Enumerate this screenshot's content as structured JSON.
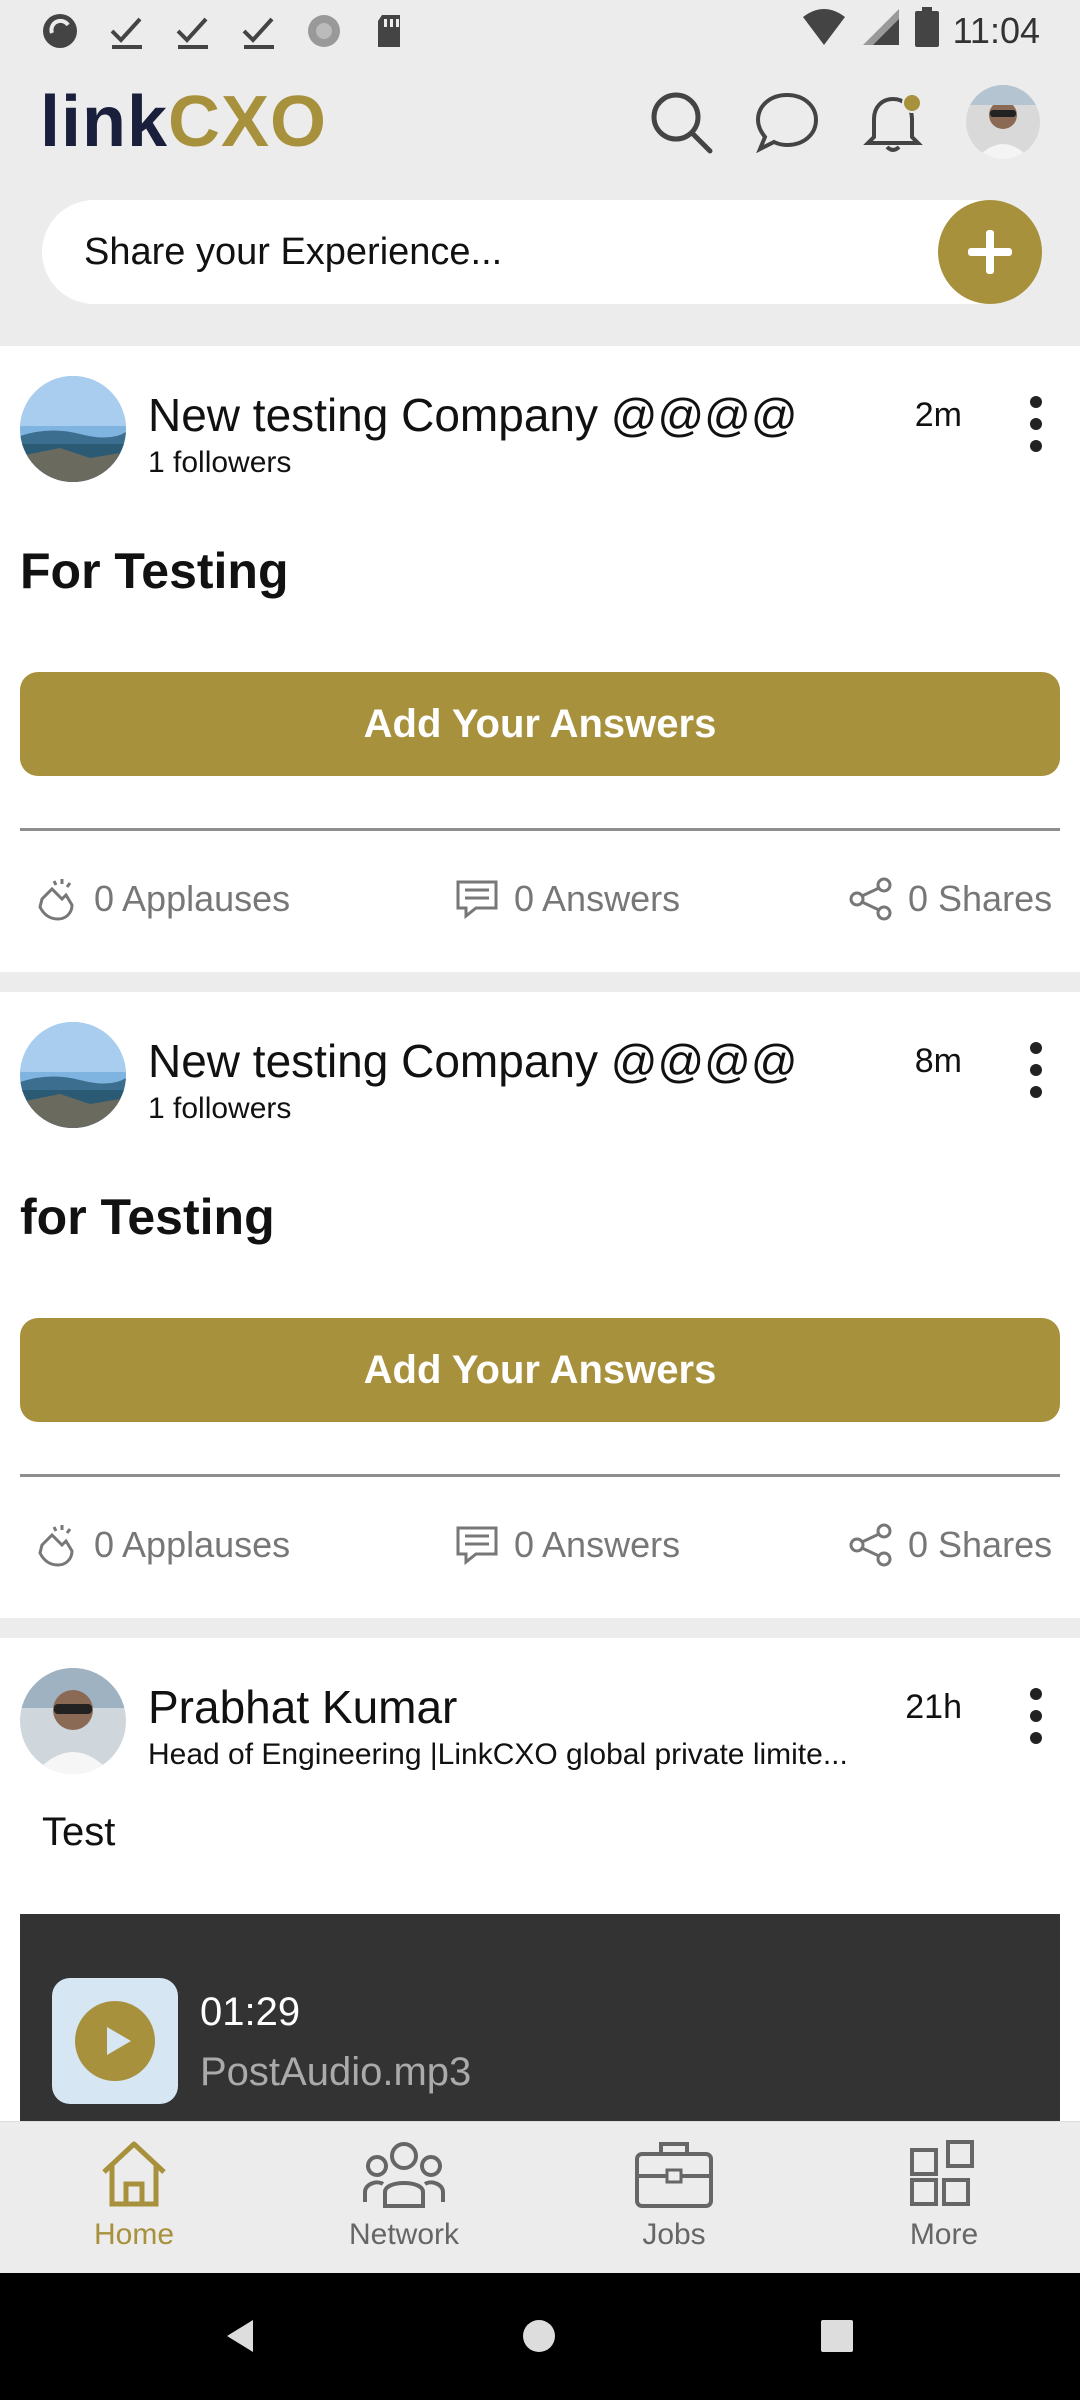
{
  "status_bar": {
    "time": "11:04"
  },
  "header": {
    "logo_link": "link",
    "logo_cxo": "CXO"
  },
  "share": {
    "placeholder": "Share your Experience..."
  },
  "posts": [
    {
      "author": "New testing Company @@@@",
      "followers": "1 followers",
      "time": "2m",
      "title": "For Testing",
      "button": "Add Your Answers",
      "applauses": "0 Applauses",
      "answers": "0 Answers",
      "shares": "0 Shares"
    },
    {
      "author": "New testing Company @@@@",
      "followers": "1 followers",
      "time": "8m",
      "title": "for Testing",
      "button": "Add Your Answers",
      "applauses": "0 Applauses",
      "answers": "0 Answers",
      "shares": "0 Shares"
    },
    {
      "author": "Prabhat Kumar",
      "subtitle": "Head of Engineering |LinkCXO global private limite...",
      "time": "21h",
      "text": "Test",
      "audio_time": "01:29",
      "audio_file": "PostAudio.mp3"
    }
  ],
  "bottom_nav": [
    {
      "label": "Home",
      "icon": "home-icon",
      "active": true
    },
    {
      "label": "Network",
      "icon": "network-icon",
      "active": false
    },
    {
      "label": "Jobs",
      "icon": "briefcase-icon",
      "active": false
    },
    {
      "label": "More",
      "icon": "grid-icon",
      "active": false
    }
  ],
  "colors": {
    "accent": "#a8913c",
    "navy": "#1a1f3c",
    "background": "#ececec"
  }
}
